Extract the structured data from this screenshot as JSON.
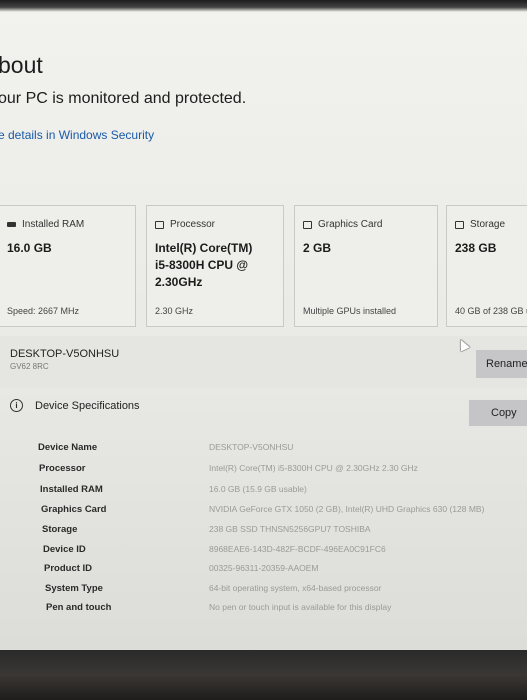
{
  "header": {
    "title": "bout",
    "protection_status": "our PC is monitored and protected.",
    "security_link": "e details in Windows Security"
  },
  "cards": [
    {
      "icon": "ram-icon",
      "label": "Installed RAM",
      "value": "16.0 GB",
      "sub": "Speed: 2667 MHz"
    },
    {
      "icon": "processor-icon",
      "label": "Processor",
      "value_lines": [
        "Intel(R) Core(TM)",
        "i5-8300H CPU @",
        "2.30GHz"
      ],
      "sub": "2.30 GHz"
    },
    {
      "icon": "graphics-card-icon",
      "label": "Graphics Card",
      "value": "2 GB",
      "sub": "Multiple GPUs installed"
    },
    {
      "icon": "storage-icon",
      "label": "Storage",
      "value": "238 GB",
      "sub": "40 GB of 238 GB u"
    }
  ],
  "device": {
    "name": "DESKTOP-V5ONHSU",
    "model": "GV62 8RC",
    "rename_label": "Rename"
  },
  "specs": {
    "title": "Device Specifications",
    "copy_label": "Copy",
    "rows": [
      {
        "label": "Device Name",
        "value": "DESKTOP-V5ONHSU"
      },
      {
        "label": "Processor",
        "value": "Intel(R) Core(TM) i5-8300H CPU @ 2.30GHz   2.30 GHz"
      },
      {
        "label": "Installed RAM",
        "value": "16.0 GB (15.9 GB usable)"
      },
      {
        "label": "Graphics Card",
        "value": "NVIDIA GeForce GTX 1050 (2 GB), Intel(R) UHD Graphics 630 (128 MB)"
      },
      {
        "label": "Storage",
        "value": "238 GB SSD THNSN5256GPU7 TOSHIBA"
      },
      {
        "label": "Device ID",
        "value": "8968EAE6-143D-482F-BCDF-496EA0C91FC6"
      },
      {
        "label": "Product ID",
        "value": "00325-96311-20359-AAOEM"
      },
      {
        "label": "System Type",
        "value": "64-bit operating system, x64-based processor"
      },
      {
        "label": "Pen and touch",
        "value": "No pen or touch input is available for this display"
      }
    ]
  }
}
